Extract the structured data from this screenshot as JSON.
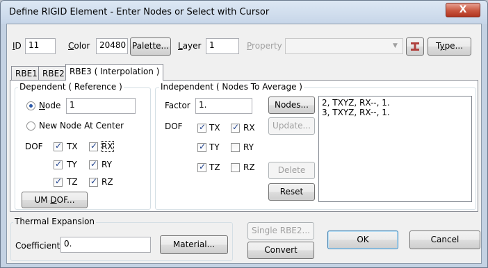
{
  "window": {
    "title": "Define RIGID Element - Enter Nodes or Select with Cursor",
    "close_glyph": "X"
  },
  "top": {
    "id_label": "ID",
    "id_value": "11",
    "color_label": "Color",
    "color_value": "20480",
    "palette_button": "Palette...",
    "layer_label": "Layer",
    "layer_value": "1",
    "property_label": "Property",
    "property_value": "",
    "type_button": "Type..."
  },
  "tabs": [
    "RBE1",
    "RBE2",
    "RBE3 ( Interpolation )"
  ],
  "dependent": {
    "title": "Dependent ( Reference )",
    "node_label": "Node",
    "node_value": "1",
    "new_node_label": "New Node At Center",
    "dof_label": "DOF",
    "dofs": [
      {
        "label": "TX",
        "checked": true
      },
      {
        "label": "RX",
        "checked": true
      },
      {
        "label": "TY",
        "checked": true
      },
      {
        "label": "RY",
        "checked": true
      },
      {
        "label": "TZ",
        "checked": true
      },
      {
        "label": "RZ",
        "checked": true
      }
    ],
    "um_dof_button": "UM DOF..."
  },
  "independent": {
    "title": "Independent ( Nodes To Average )",
    "factor_label": "Factor",
    "factor_value": "1.",
    "dof_label": "DOF",
    "dofs": [
      {
        "label": "TX",
        "checked": true
      },
      {
        "label": "RX",
        "checked": true
      },
      {
        "label": "TY",
        "checked": true
      },
      {
        "label": "RY",
        "checked": false
      },
      {
        "label": "TZ",
        "checked": true
      },
      {
        "label": "RZ",
        "checked": false
      }
    ],
    "nodes_button": "Nodes...",
    "update_button": "Update...",
    "delete_button": "Delete",
    "reset_button": "Reset",
    "list": [
      "2, TXYZ, RX--, 1.",
      "3, TXYZ, RX--, 1."
    ]
  },
  "thermal": {
    "title": "Thermal Expansion",
    "coef_label": "Coefficient",
    "coef_value": "0.",
    "material_button": "Material..."
  },
  "bottom": {
    "single_rbe2_button": "Single RBE2...",
    "convert_button": "Convert",
    "ok_button": "OK",
    "cancel_button": "Cancel"
  },
  "icons": {
    "property_pick": "i-beam-icon",
    "dropdown": "chevron-down-icon"
  }
}
